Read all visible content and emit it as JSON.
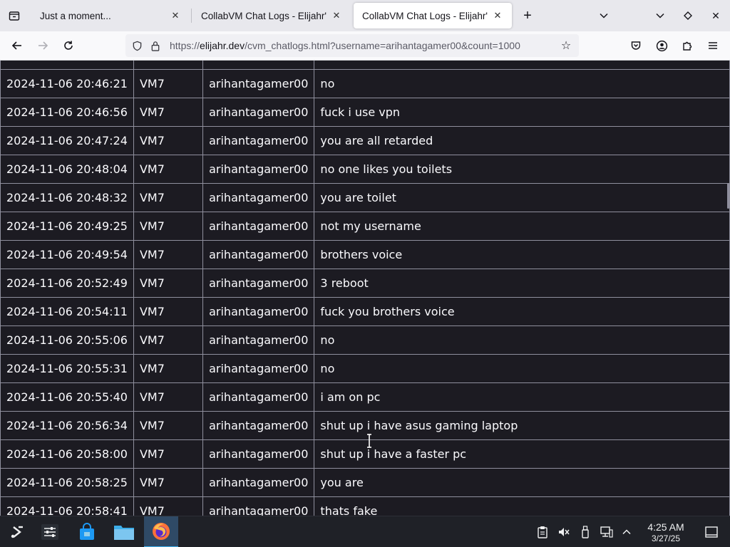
{
  "tabs": [
    {
      "title": "Just a moment..."
    },
    {
      "title": "CollabVM Chat Logs - Elijahr's"
    },
    {
      "title": "CollabVM Chat Logs - Elijahr's"
    }
  ],
  "address_bar": {
    "url_prefix": "https://",
    "url_host": "elijahr.dev",
    "url_path": "/cvm_chatlogs.html?username=arihantagamer00&count=1000"
  },
  "chat_logs": {
    "rows": [
      {
        "date": "2024-11-06 20:46:21",
        "vm": "VM7",
        "user": "arihantagamer00",
        "message": "no"
      },
      {
        "date": "2024-11-06 20:46:56",
        "vm": "VM7",
        "user": "arihantagamer00",
        "message": "fuck i use vpn"
      },
      {
        "date": "2024-11-06 20:47:24",
        "vm": "VM7",
        "user": "arihantagamer00",
        "message": "you are all retarded"
      },
      {
        "date": "2024-11-06 20:48:04",
        "vm": "VM7",
        "user": "arihantagamer00",
        "message": "no one likes you toilets"
      },
      {
        "date": "2024-11-06 20:48:32",
        "vm": "VM7",
        "user": "arihantagamer00",
        "message": "you are toilet"
      },
      {
        "date": "2024-11-06 20:49:25",
        "vm": "VM7",
        "user": "arihantagamer00",
        "message": "not my username"
      },
      {
        "date": "2024-11-06 20:49:54",
        "vm": "VM7",
        "user": "arihantagamer00",
        "message": "brothers voice"
      },
      {
        "date": "2024-11-06 20:52:49",
        "vm": "VM7",
        "user": "arihantagamer00",
        "message": "3 reboot"
      },
      {
        "date": "2024-11-06 20:54:11",
        "vm": "VM7",
        "user": "arihantagamer00",
        "message": "fuck you brothers voice"
      },
      {
        "date": "2024-11-06 20:55:06",
        "vm": "VM7",
        "user": "arihantagamer00",
        "message": "no"
      },
      {
        "date": "2024-11-06 20:55:31",
        "vm": "VM7",
        "user": "arihantagamer00",
        "message": "no"
      },
      {
        "date": "2024-11-06 20:55:40",
        "vm": "VM7",
        "user": "arihantagamer00",
        "message": "i am on pc"
      },
      {
        "date": "2024-11-06 20:56:34",
        "vm": "VM7",
        "user": "arihantagamer00",
        "message": "shut up i have asus gaming laptop"
      },
      {
        "date": "2024-11-06 20:58:00",
        "vm": "VM7",
        "user": "arihantagamer00",
        "message": "shut up i have a faster pc"
      },
      {
        "date": "2024-11-06 20:58:25",
        "vm": "VM7",
        "user": "arihantagamer00",
        "message": "you are"
      },
      {
        "date": "2024-11-06 20:58:41",
        "vm": "VM7",
        "user": "arihantagamer00",
        "message": "thats fake"
      }
    ]
  },
  "taskbar": {
    "time": "4:25 AM",
    "date": "3/27/25"
  },
  "colors": {
    "page_background": "#1c1b22",
    "table_border": "#8f8f9d",
    "text": "#fbfbfe",
    "taskbar": "#1f2127",
    "taskbar_accent": "#3daee9",
    "firefox_orange": "#ff7139"
  }
}
